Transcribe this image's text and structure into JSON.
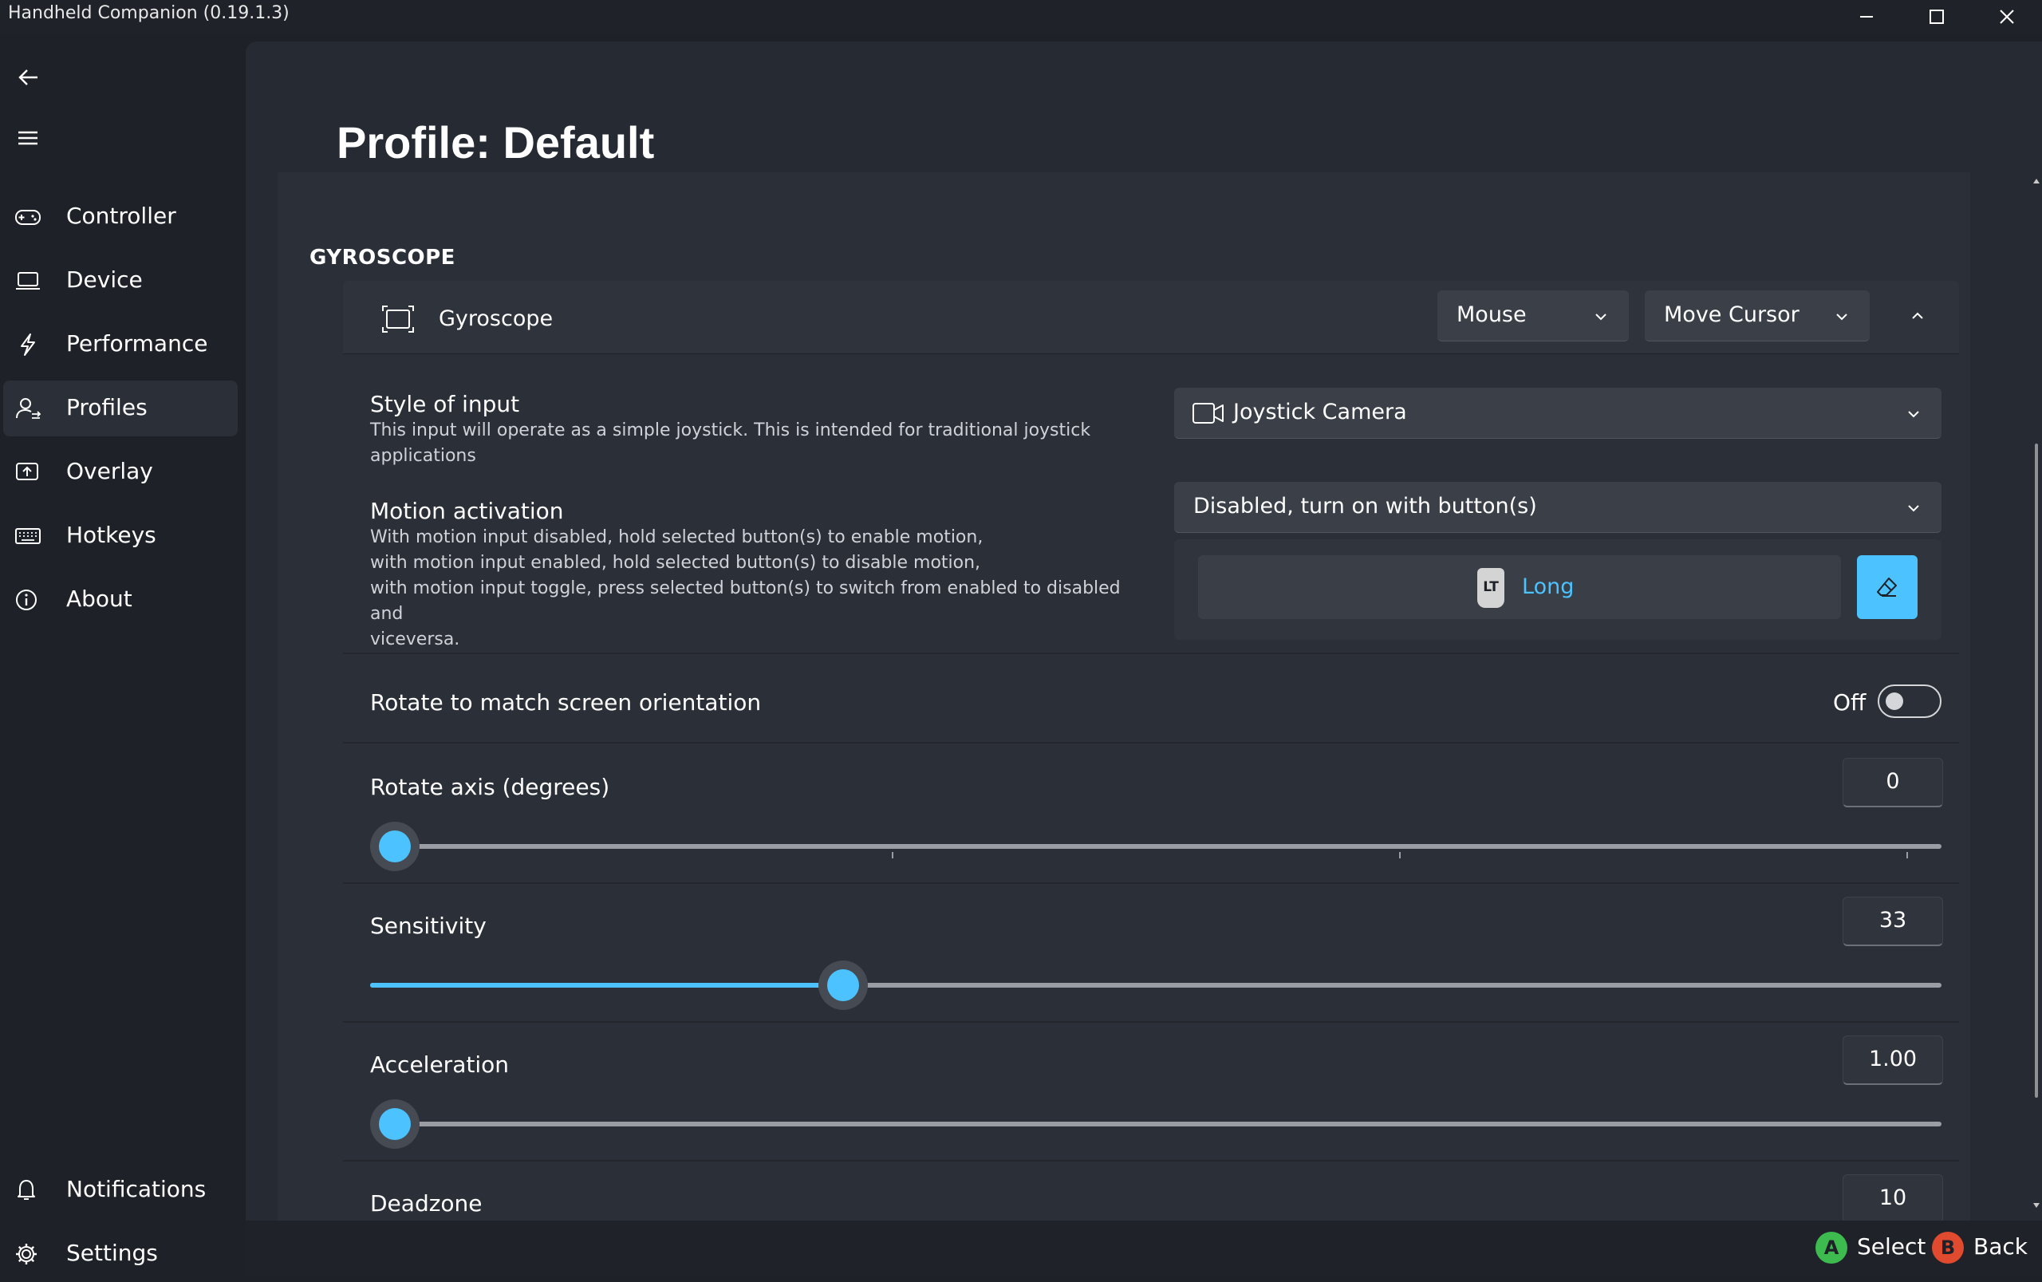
{
  "window": {
    "title": "Handheld Companion (0.19.1.3)"
  },
  "sidebar": {
    "items": [
      {
        "label": "Controller",
        "icon": "gamepad-icon"
      },
      {
        "label": "Device",
        "icon": "laptop-icon"
      },
      {
        "label": "Performance",
        "icon": "lightning-icon"
      },
      {
        "label": "Profiles",
        "icon": "profile-swap-icon"
      },
      {
        "label": "Overlay",
        "icon": "overlay-icon"
      },
      {
        "label": "Hotkeys",
        "icon": "keyboard-icon"
      },
      {
        "label": "About",
        "icon": "info-icon"
      }
    ],
    "footer": [
      {
        "label": "Notifications",
        "icon": "bell-icon"
      },
      {
        "label": "Settings",
        "icon": "gear-icon"
      }
    ]
  },
  "page": {
    "title": "Profile: Default",
    "section": "GYROSCOPE"
  },
  "gyroscope": {
    "header_label": "Gyroscope",
    "output_device": "Mouse",
    "output_action": "Move Cursor",
    "style_of_input": {
      "title": "Style of input",
      "description": "This input will operate as a simple joystick. This is intended for traditional joystick applications",
      "value": "Joystick Camera"
    },
    "motion_activation": {
      "title": "Motion activation",
      "description_lines": [
        "With motion input disabled, hold selected button(s) to enable motion,",
        "with motion input enabled, hold selected button(s) to disable motion,",
        "with motion input toggle, press selected button(s) to switch from enabled to disabled and",
        "viceversa."
      ],
      "value": "Disabled, turn on with button(s)",
      "button_glyph": "LT",
      "button_label": "Long"
    },
    "rotate_orientation": {
      "title": "Rotate to match screen orientation",
      "state": "Off",
      "on": false
    },
    "rotate_axis": {
      "title": "Rotate axis (degrees)",
      "value": "0",
      "fraction": 0.0
    },
    "sensitivity": {
      "title": "Sensitivity",
      "value": "33",
      "fraction": 0.3
    },
    "acceleration": {
      "title": "Acceleration",
      "value": "1.00",
      "fraction": 0.0
    },
    "deadzone": {
      "title": "Deadzone",
      "value": "10"
    }
  },
  "bottombar": {
    "select_key": "A",
    "select_label": "Select",
    "back_key": "B",
    "back_label": "Back"
  },
  "colors": {
    "accent": "#4cc2ff",
    "a_button": "#3dbb4f",
    "b_button": "#e04a2f"
  }
}
